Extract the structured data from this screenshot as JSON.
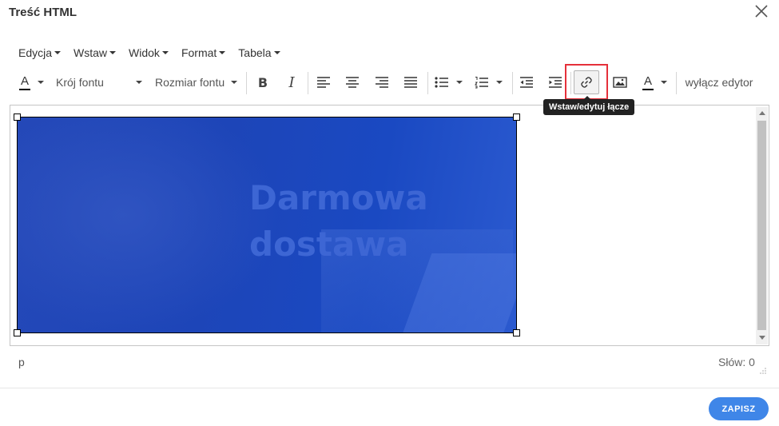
{
  "dialog": {
    "title": "Treść HTML"
  },
  "menubar": {
    "items": [
      {
        "label": "Edycja"
      },
      {
        "label": "Wstaw"
      },
      {
        "label": "Widok"
      },
      {
        "label": "Format"
      },
      {
        "label": "Tabela"
      }
    ]
  },
  "toolbar": {
    "font_family": "Krój fontu",
    "font_size": "Rozmiar fontu",
    "text_color_letter": "A",
    "bg_color_letter": "A",
    "bold_label": "B",
    "italic_label": "I",
    "disable_editor": "wyłącz edytor",
    "active_tool_tooltip": "Wstaw/edytuj łącze",
    "icons": [
      "text-color-icon",
      "bold-icon",
      "italic-icon",
      "align-left-icon",
      "align-center-icon",
      "align-right-icon",
      "align-justify-icon",
      "bullet-list-icon",
      "numbered-list-icon",
      "outdent-icon",
      "indent-icon",
      "link-icon",
      "image-icon",
      "background-color-icon"
    ],
    "highlight_color": "#e5303a"
  },
  "editor": {
    "banner_text_line1": "Darmowa",
    "banner_text_line2": "dostawa",
    "banner_color": "#1d45b8"
  },
  "statusbar": {
    "path": "p",
    "word_count": "Słów: 0"
  },
  "footer": {
    "save_label": "ZAPISZ",
    "save_color": "#3f86e8"
  }
}
